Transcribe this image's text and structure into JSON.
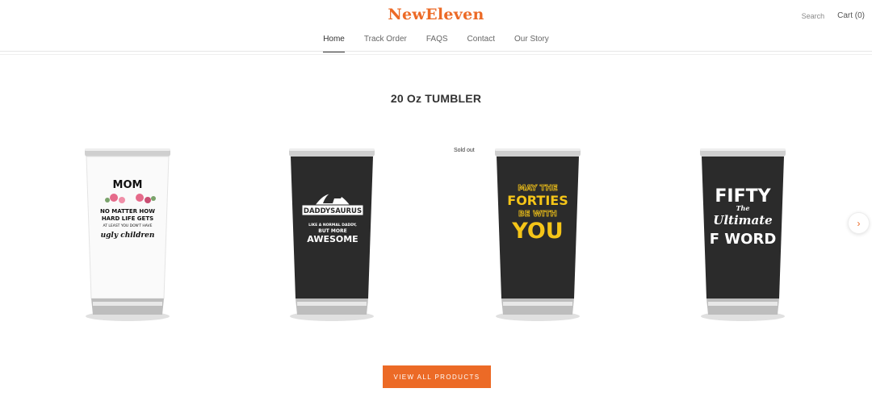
{
  "header": {
    "logo": "NewEleven",
    "search_label": "Search",
    "cart_label": "Cart (0)",
    "nav": [
      {
        "label": "Home",
        "active": true
      },
      {
        "label": "Track Order"
      },
      {
        "label": "FAQS"
      },
      {
        "label": "Contact"
      },
      {
        "label": "Our Story"
      }
    ]
  },
  "section": {
    "title": "20 Oz TUMBLER",
    "sold_out_badge": "Sold out",
    "products": [
      {
        "body": "white",
        "lines": [
          "MOM",
          "NO MATTER HOW",
          "HARD LIFE GETS",
          "AT LEAST YOU DON'T HAVE",
          "ugly children"
        ]
      },
      {
        "body": "black",
        "lines": [
          "DADDYSAURUS",
          "LIKE A NORMAL DADDY,",
          "BUT MORE",
          "AWESOME"
        ]
      },
      {
        "body": "black",
        "lines": [
          "MAY THE",
          "FORTIES",
          "BE WITH",
          "YOU"
        ]
      },
      {
        "body": "black",
        "lines": [
          "FIFTY",
          "The",
          "Ultimate",
          "F WORD"
        ]
      }
    ],
    "view_all_label": "VIEW ALL PRODUCTS"
  },
  "colors": {
    "accent": "#ec6a26",
    "tumbler_black": "#2b2b2b",
    "tumbler_white": "#fafafa",
    "print_yellow": "#f5c518",
    "print_pink": "#e56a8a"
  }
}
